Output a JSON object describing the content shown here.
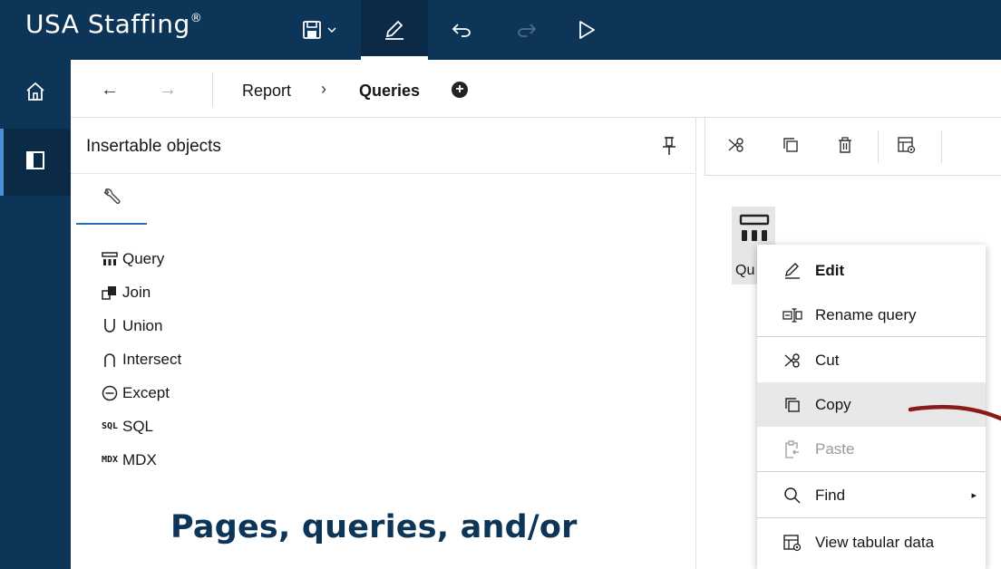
{
  "header": {
    "brand": "USA Staffing",
    "brand_mark": "®",
    "buttons": {
      "save": "save-icon",
      "save_menu": "chevron-down-icon",
      "edit": "pencil-icon",
      "undo": "undo-icon",
      "redo": "redo-icon",
      "run": "play-icon"
    }
  },
  "rail": {
    "items": [
      "home-icon",
      "panel-icon"
    ]
  },
  "breadcrumb": {
    "back": "←",
    "forward": "→",
    "items": [
      "Report",
      "Queries"
    ],
    "separator": "›",
    "add": "+"
  },
  "panel": {
    "title": "Insertable objects",
    "tab_icon": "wrench-icon",
    "objects": [
      {
        "label": "Query",
        "icon": "query-icon"
      },
      {
        "label": "Join",
        "icon": "join-icon"
      },
      {
        "label": "Union",
        "icon": "union-icon"
      },
      {
        "label": "Intersect",
        "icon": "intersect-icon"
      },
      {
        "label": "Except",
        "icon": "except-icon"
      },
      {
        "label": "SQL",
        "icon": "sql-icon",
        "icon_text": "SQL"
      },
      {
        "label": "MDX",
        "icon": "mdx-icon",
        "icon_text": "MDX"
      }
    ]
  },
  "caption": "Pages, queries, and/or",
  "canvas": {
    "toolbar": [
      "cut-icon",
      "copy-icon",
      "delete-icon",
      "view-tabular-data-icon"
    ],
    "query_label": "Qu"
  },
  "context_menu": {
    "items": [
      {
        "label": "Edit",
        "icon": "pencil-icon",
        "bold": true
      },
      {
        "label": "Rename query",
        "icon": "rename-icon"
      },
      {
        "label": "Cut",
        "icon": "cut-icon"
      },
      {
        "label": "Copy",
        "icon": "copy-icon",
        "highlighted": true
      },
      {
        "label": "Paste",
        "icon": "paste-icon",
        "disabled": true
      },
      {
        "label": "Find",
        "icon": "search-icon",
        "submenu": "▸"
      },
      {
        "label": "View tabular data",
        "icon": "view-tabular-data-icon"
      }
    ]
  },
  "colors": {
    "header_bg": "#0d3557",
    "caption": "#0d3557",
    "annotation_line": "#8b1a1a",
    "tab_underline": "#2a6db3"
  }
}
